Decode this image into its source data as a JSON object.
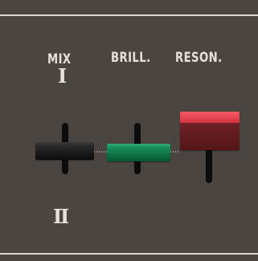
{
  "controls": {
    "mix": {
      "label": "MIX",
      "top_marker": "Ⅰ",
      "bottom_marker": "Ⅱ",
      "cap_color": "#1a1a1a"
    },
    "brill": {
      "label": "BRILL.",
      "cap_color": "#0f7a4a"
    },
    "reson": {
      "label": "RESON.",
      "cap_color": "#d7323e"
    }
  },
  "colors": {
    "panel_background": "#4a4541",
    "label_text": "#e4e1dc",
    "rule_line": "#d9d6d2",
    "slider_track": "#0d0c0c"
  }
}
